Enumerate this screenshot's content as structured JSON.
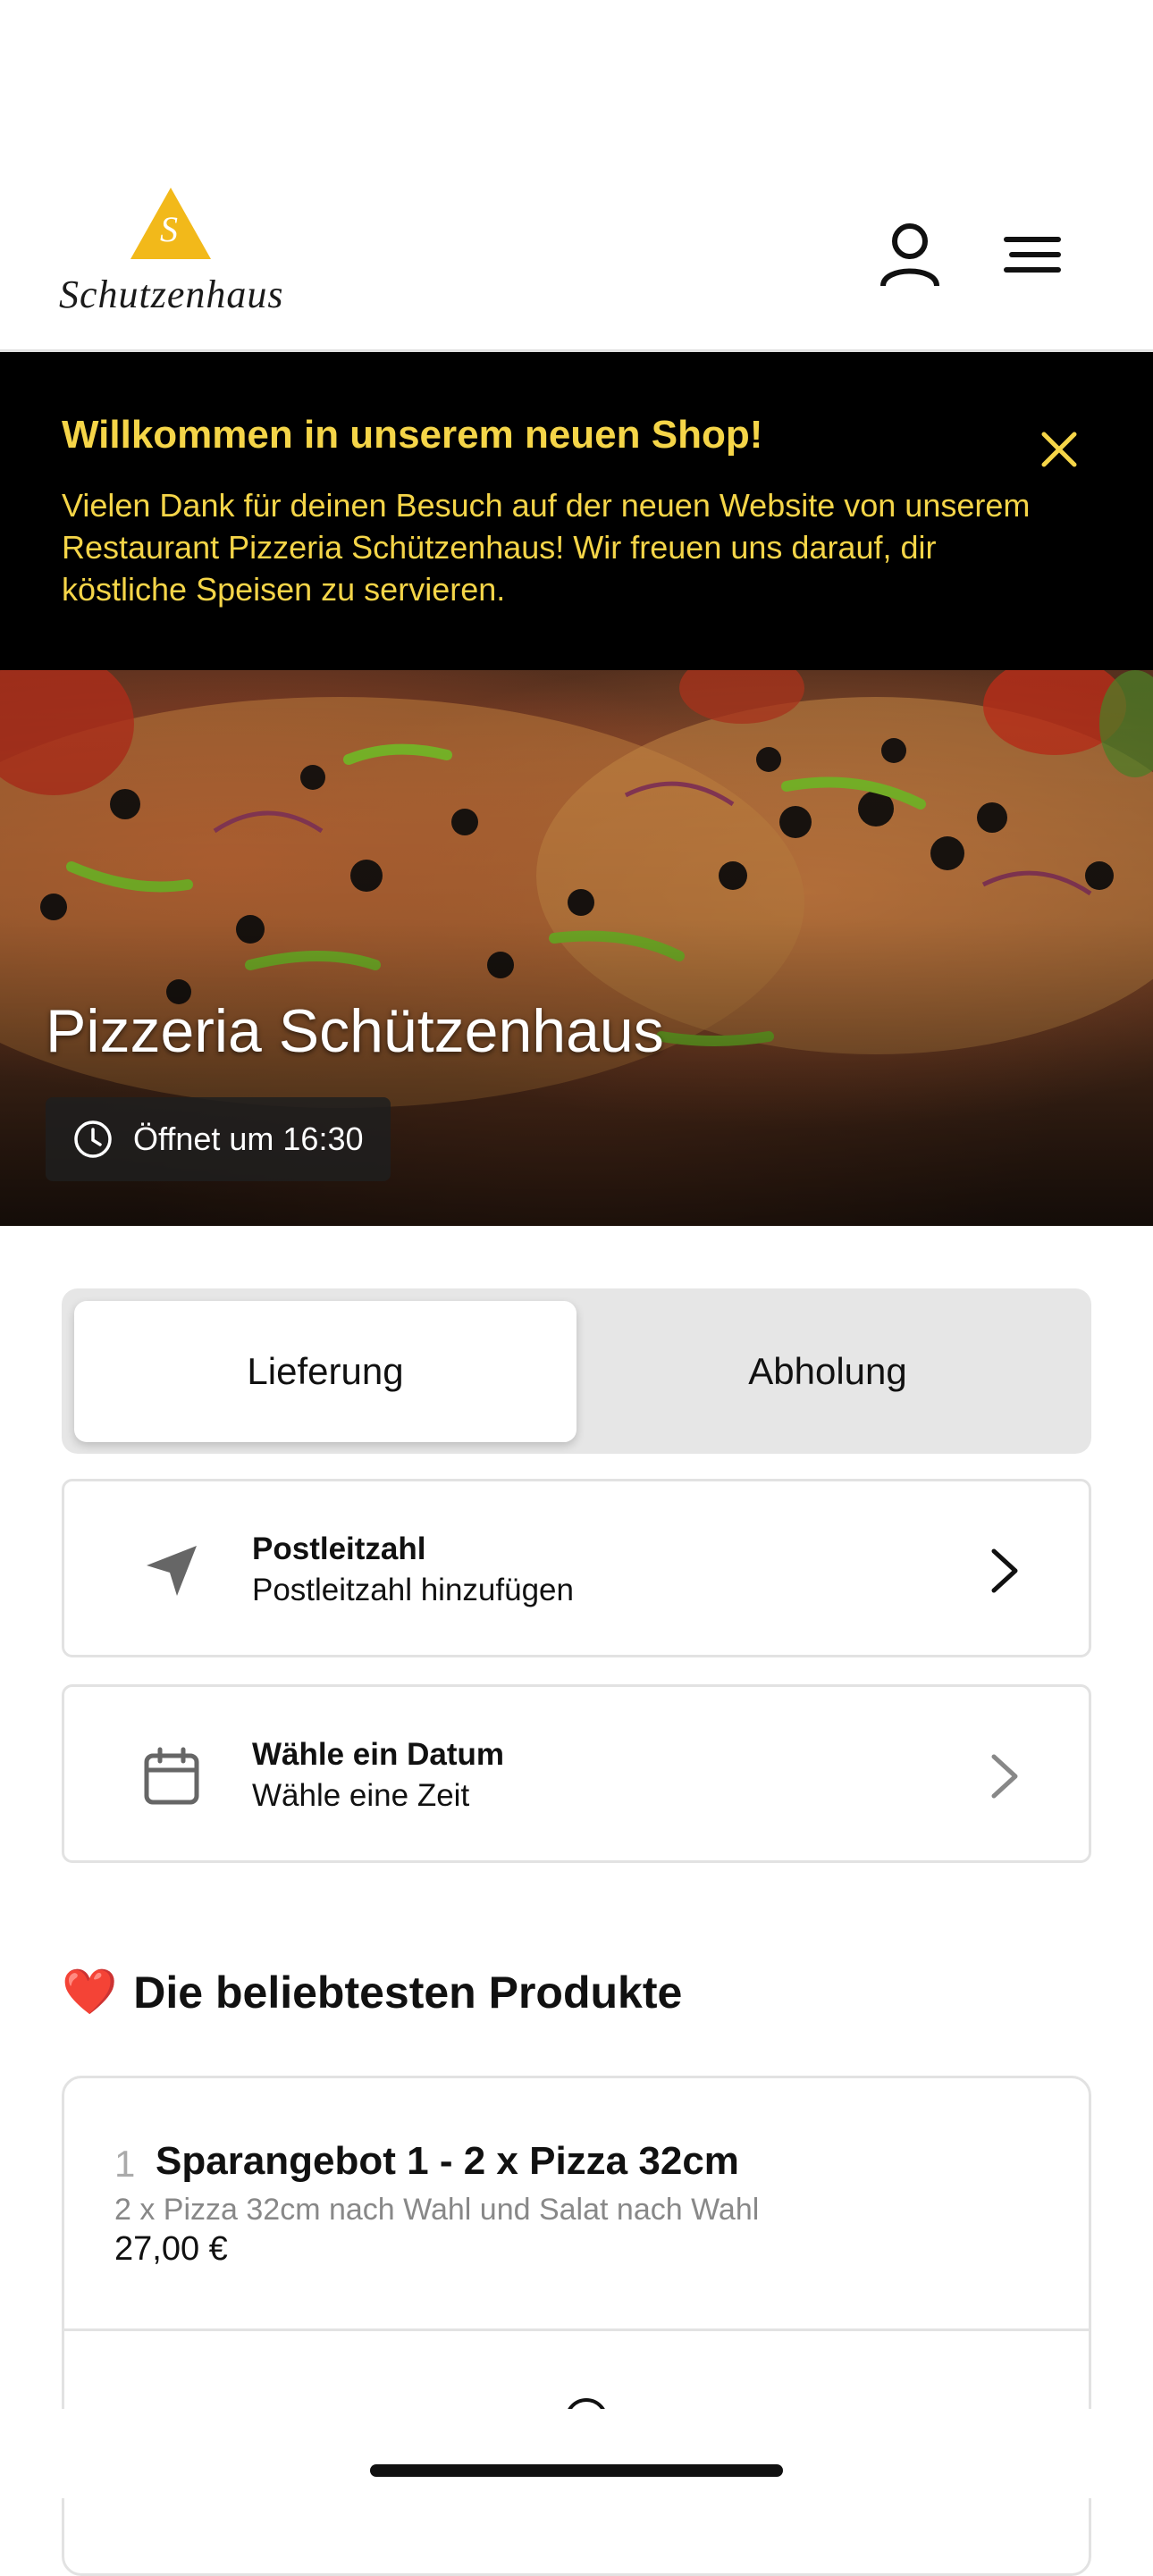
{
  "header": {
    "logo": {
      "icon": "triangle-logo-icon",
      "letter": "S",
      "text": "Schutzenhaus"
    },
    "user_icon": "user-icon",
    "menu_icon": "hamburger-menu-icon"
  },
  "banner": {
    "title": "Willkommen in unserem neuen Shop!",
    "text": "Vielen Dank für deinen Besuch auf der neuen Website von unserem Restaurant Pizzeria Schützenhaus! Wir freuen uns darauf, dir köstliche Speisen zu servieren.",
    "close_icon": "close-icon",
    "text_color": "#f5d548",
    "background": "#000000"
  },
  "hero": {
    "title": "Pizzeria Schützenhaus",
    "status": "Öffnet um 16:30",
    "status_icon": "clock-icon"
  },
  "order_mode": {
    "options": [
      "Lieferung",
      "Abholung"
    ],
    "selected": "Lieferung"
  },
  "postcode_card": {
    "title": "Postleitzahl",
    "subtitle": "Postleitzahl hinzufügen",
    "icon": "location-arrow-icon"
  },
  "date_card": {
    "title": "Wähle ein Datum",
    "subtitle": "Wähle eine Zeit",
    "icon": "calendar-icon"
  },
  "popular": {
    "emoji": "❤️",
    "title": "Die beliebtesten Produkte",
    "items": [
      {
        "rank": "1",
        "name": "Sparangebot 1 - 2 x Pizza 32cm",
        "description": "2 x Pizza 32cm nach Wahl und Salat nach Wahl",
        "price": "27,00 €"
      }
    ]
  }
}
